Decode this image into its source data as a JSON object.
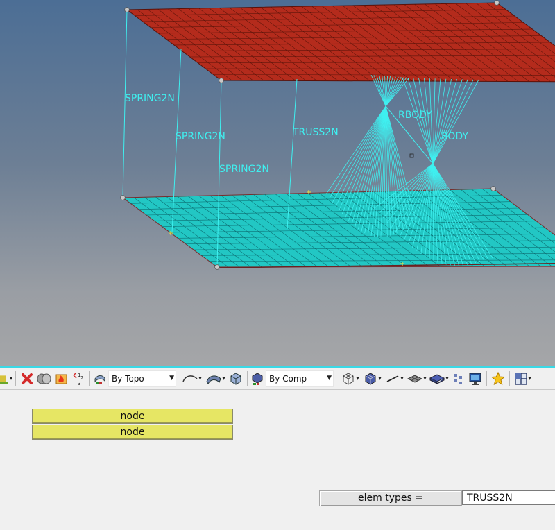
{
  "viewport": {
    "labels": {
      "spring_a": "SPRING2N",
      "spring_b": "SPRING2N",
      "spring_c": "SPRING2N",
      "truss": "TRUSS2N",
      "rbody_a": "RBODY",
      "rbody_b": "BODY"
    },
    "colors": {
      "top_plate": "#b42b1c",
      "bottom_plate": "#22c7c4",
      "element_lines": "#3ff0f0"
    }
  },
  "toolbar": {
    "topo_dropdown": "By Topo",
    "comp_dropdown": "By Comp",
    "icons": [
      "component-icon",
      "delete-icon",
      "cylinders-icon",
      "fire-icon",
      "renumber-icon",
      "geometry-color-icon",
      "surface-edge-icon",
      "surface-icon",
      "solid-icon",
      "element-color-icon",
      "wireframe-icon",
      "shaded-elements-icon",
      "line-icon",
      "plate-icon",
      "shell-icon",
      "mesh-display-icon",
      "monitor-icon",
      "star-icon",
      "window-icon"
    ]
  },
  "panel": {
    "node_1": "node",
    "node_2": "node",
    "elem_types_label": "elem types =",
    "elem_types_value": "TRUSS2N"
  }
}
